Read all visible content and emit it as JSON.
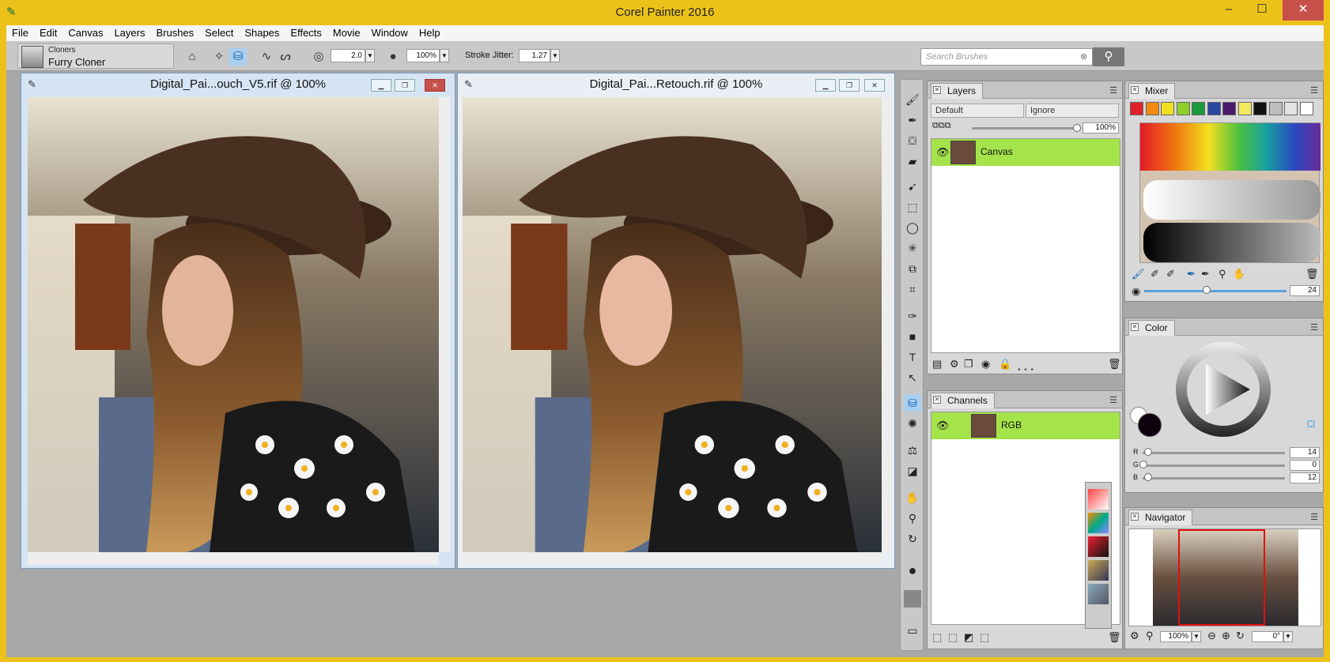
{
  "app": {
    "title": "Corel Painter 2016"
  },
  "menu": [
    "File",
    "Edit",
    "Canvas",
    "Layers",
    "Brushes",
    "Select",
    "Shapes",
    "Effects",
    "Movie",
    "Window",
    "Help"
  ],
  "brush": {
    "category": "Cloners",
    "variant": "Furry Cloner"
  },
  "property_bar": {
    "size": "2.0",
    "opacity": "100%",
    "stroke_jitter_label": "Stroke Jitter:",
    "stroke_jitter": "1.27"
  },
  "search": {
    "placeholder": "Search Brushes"
  },
  "documents": [
    {
      "title": "Digital_Pai...ouch_V5.rif @ 100%"
    },
    {
      "title": "Digital_Pai...Retouch.rif @ 100%"
    }
  ],
  "layers": {
    "title": "Layers",
    "composite_method": "Default",
    "depth": "Ignore",
    "opacity": "100%",
    "items": [
      "Canvas"
    ]
  },
  "channels": {
    "title": "Channels",
    "items": [
      "RGB"
    ]
  },
  "mixer": {
    "title": "Mixer",
    "swatches": [
      "#e0202a",
      "#f08a10",
      "#f2e020",
      "#8ccf2a",
      "#1a9a3a",
      "#2a4aa0",
      "#4a1a6a",
      "#f4ea60",
      "#111111",
      "#bdbdbd",
      "#e4e4e4",
      "#ffffff"
    ],
    "brush_size": "24"
  },
  "color": {
    "title": "Color",
    "r": "14",
    "g": "0",
    "b": "12"
  },
  "navigator": {
    "title": "Navigator",
    "zoom": "100%",
    "rotation": "0°"
  },
  "colors": {
    "accent_yellow": "#ecc21a",
    "layer_selected": "#a5e34a",
    "close_red": "#c7514a"
  }
}
